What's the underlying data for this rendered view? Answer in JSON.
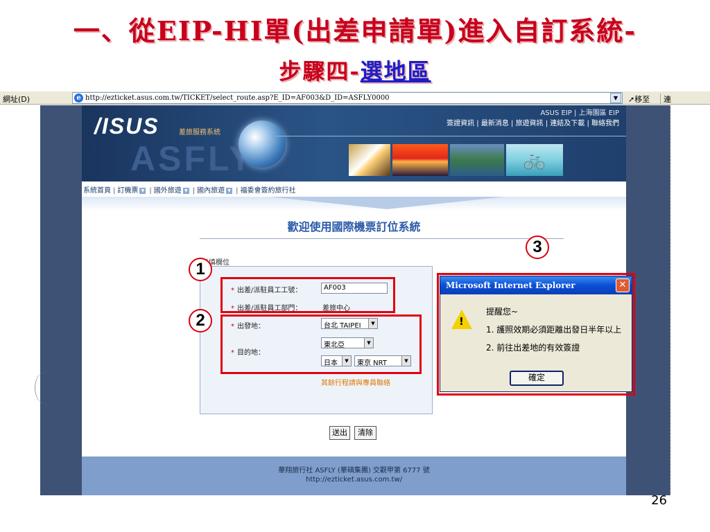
{
  "slide": {
    "title_line1": "一、從EIP-HI單(出差申請單)進入自訂系統-",
    "title_line2_prefix": "步驟四-",
    "title_line2_link": "選地區",
    "page_number": "26"
  },
  "browser": {
    "address_label": "網址(D)",
    "url": "http://ezticket.asus.com.tw/TICKET/select_route.asp?E_ID=AF003&D_ID=ASFLY0000",
    "go_label": "移至",
    "links_label": "連"
  },
  "site_header": {
    "logo": "/ISUS",
    "logo_sub": "差旅服務系統",
    "asfly": "ASFLY",
    "top_right_line1": "ASUS EIP | 上海園區 EIP",
    "top_right_line2": "簽證資訊 | 最新消息 | 旅遊資訊 | 連結及下載 | 聯絡我們"
  },
  "nav": {
    "home": "系統首頁",
    "tickets": "訂機票",
    "overseas": "國外旅遊",
    "domestic": "國內旅遊",
    "welfare": "福委會簽約旅行社"
  },
  "content": {
    "welcome": "歡迎使用國際機票訂位系統",
    "required_note": "必填欄位",
    "employee_id_label": "出差/派駐員工工號：",
    "employee_id_value": "AF003",
    "dept_label": "出差/派駐員工部門：",
    "dept_value": "差旅中心",
    "origin_label": "出發地：",
    "origin_value": "台北 TAIPEI",
    "dest_label": "目的地：",
    "dest_region": "東北亞",
    "dest_country": "日本",
    "dest_city": "東京 NRT",
    "other_note": "其餘行程請與專員聯絡",
    "submit": "送出",
    "clear": "清除"
  },
  "footer": {
    "line1": "華翔旅行社 ASFLY (華碩集團) 交觀甲第 6777 號",
    "line2": "http://ezticket.asus.com.tw/"
  },
  "callouts": {
    "n1": "1",
    "n2": "2",
    "n3": "3"
  },
  "dialog": {
    "title": "Microsoft Internet Explorer",
    "close": "✕",
    "line1": "提醒您~",
    "line2": "1. 護照效期必須距離出發日半年以上",
    "line3": "2. 前往出差地的有效簽證",
    "ok": "確定"
  },
  "colors": {
    "title_red": "#c8001c",
    "callout_red": "#e00010",
    "header_navy": "#1d3d68",
    "footer_blue": "#7f9ecb"
  }
}
